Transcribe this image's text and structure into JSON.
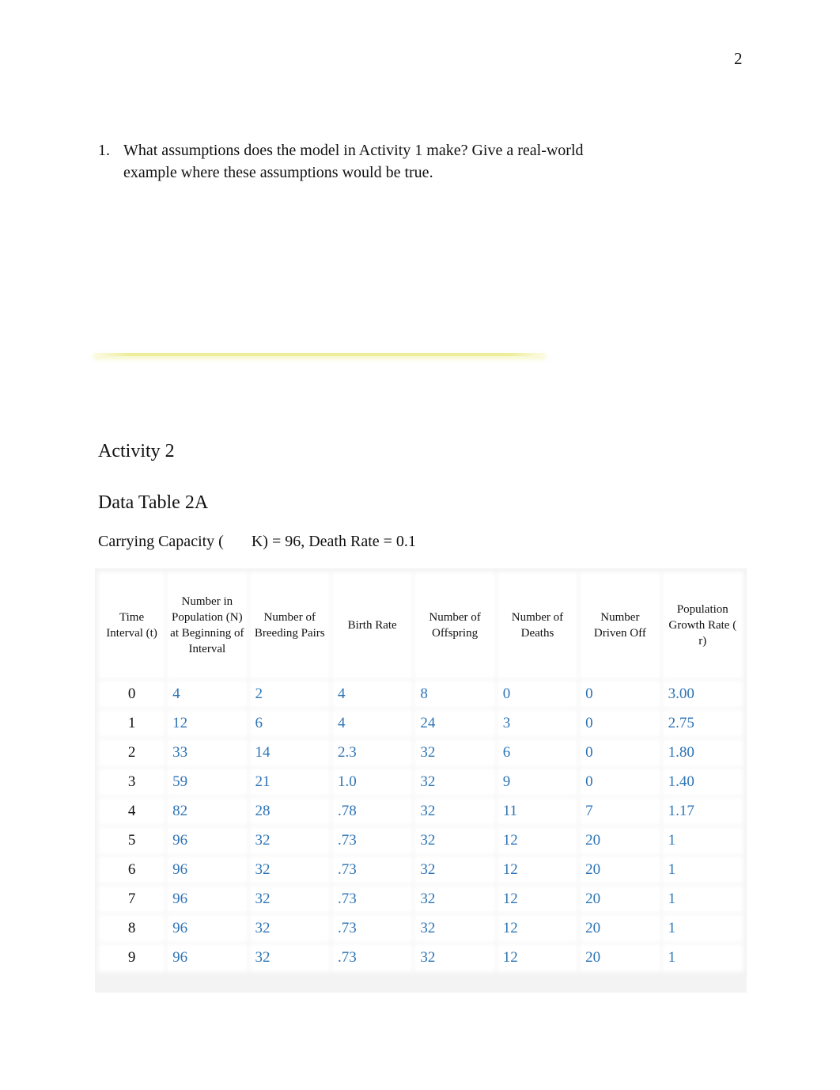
{
  "page_number": "2",
  "question": {
    "number": "1.",
    "text": "What assumptions does the model in Activity 1 make? Give a real-world example where these assumptions would be true."
  },
  "activity_heading": "Activity 2",
  "table_heading": "Data Table 2A",
  "caption": "Carrying Capacity (       K) = 96, Death Rate = 0.1",
  "colors": {
    "value_text": "#2e74b5",
    "highlight": "#eded9a"
  },
  "table": {
    "headers": [
      "Time Interval (t)",
      "Number in Population (N) at Beginning of Interval",
      "Number of Breeding Pairs",
      "Birth Rate",
      "Number of Offspring",
      "Number of Deaths",
      "Number Driven Off",
      "Population Growth Rate (  r)"
    ],
    "rows": [
      [
        "0",
        "4",
        "2",
        "4",
        "8",
        "0",
        "0",
        "3.00"
      ],
      [
        "1",
        "12",
        "6",
        "4",
        "24",
        "3",
        "0",
        "2.75"
      ],
      [
        "2",
        "33",
        "14",
        "2.3",
        "32",
        "6",
        "0",
        "1.80"
      ],
      [
        "3",
        "59",
        "21",
        "1.0",
        "32",
        "9",
        "0",
        "1.40"
      ],
      [
        "4",
        "82",
        "28",
        ".78",
        "32",
        "11",
        "7",
        "1.17"
      ],
      [
        "5",
        "96",
        "32",
        ".73",
        "32",
        "12",
        "20",
        "1"
      ],
      [
        "6",
        "96",
        "32",
        ".73",
        "32",
        "12",
        "20",
        "1"
      ],
      [
        "7",
        "96",
        "32",
        ".73",
        "32",
        "12",
        "20",
        "1"
      ],
      [
        "8",
        "96",
        "32",
        ".73",
        "32",
        "12",
        "20",
        "1"
      ],
      [
        "9",
        "96",
        "32",
        ".73",
        "32",
        "12",
        "20",
        "1"
      ]
    ]
  }
}
